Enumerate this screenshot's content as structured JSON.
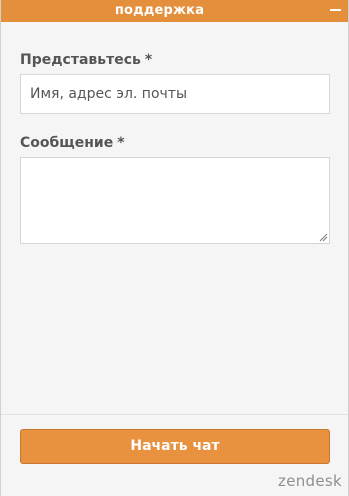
{
  "header": {
    "title": "поддержка",
    "minimize_icon": "minimize-icon"
  },
  "form": {
    "name_label": "Представьтесь",
    "name_required_mark": "*",
    "name_placeholder": "Имя, адрес эл. почты",
    "name_value": "",
    "message_label": "Сообщение",
    "message_required_mark": "*",
    "message_value": ""
  },
  "actions": {
    "start_chat_label": "Начать чат"
  },
  "footer": {
    "brand": "zendesk"
  },
  "colors": {
    "accent": "#e38f3c",
    "button": "#e8913f",
    "background": "#f5f5f5",
    "label_text": "#555555"
  }
}
